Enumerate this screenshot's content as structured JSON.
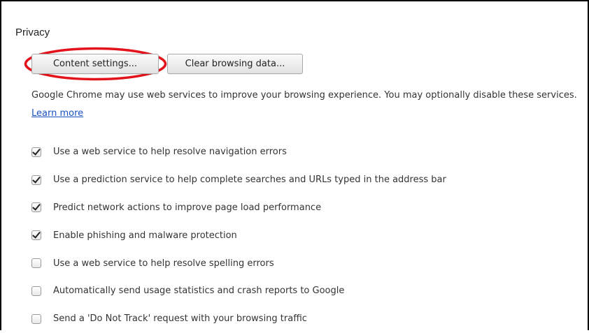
{
  "privacy": {
    "title": "Privacy",
    "buttons": {
      "content_settings": "Content settings...",
      "clear_browsing_data": "Clear browsing data..."
    },
    "description": "Google Chrome may use web services to improve your browsing experience. You may optionally disable these services.",
    "learn_more": "Learn more",
    "options": [
      {
        "label": "Use a web service to help resolve navigation errors",
        "checked": true
      },
      {
        "label": "Use a prediction service to help complete searches and URLs typed in the address bar",
        "checked": true
      },
      {
        "label": "Predict network actions to improve page load performance",
        "checked": true
      },
      {
        "label": "Enable phishing and malware protection",
        "checked": true
      },
      {
        "label": "Use a web service to help resolve spelling errors",
        "checked": false
      },
      {
        "label": "Automatically send usage statistics and crash reports to Google",
        "checked": false
      },
      {
        "label": "Send a 'Do Not Track' request with your browsing traffic",
        "checked": false
      }
    ]
  },
  "annotation": {
    "highlight_color": "#e3131b"
  },
  "colors": {
    "link": "#1a4fbf",
    "frame_border": "#000000"
  }
}
